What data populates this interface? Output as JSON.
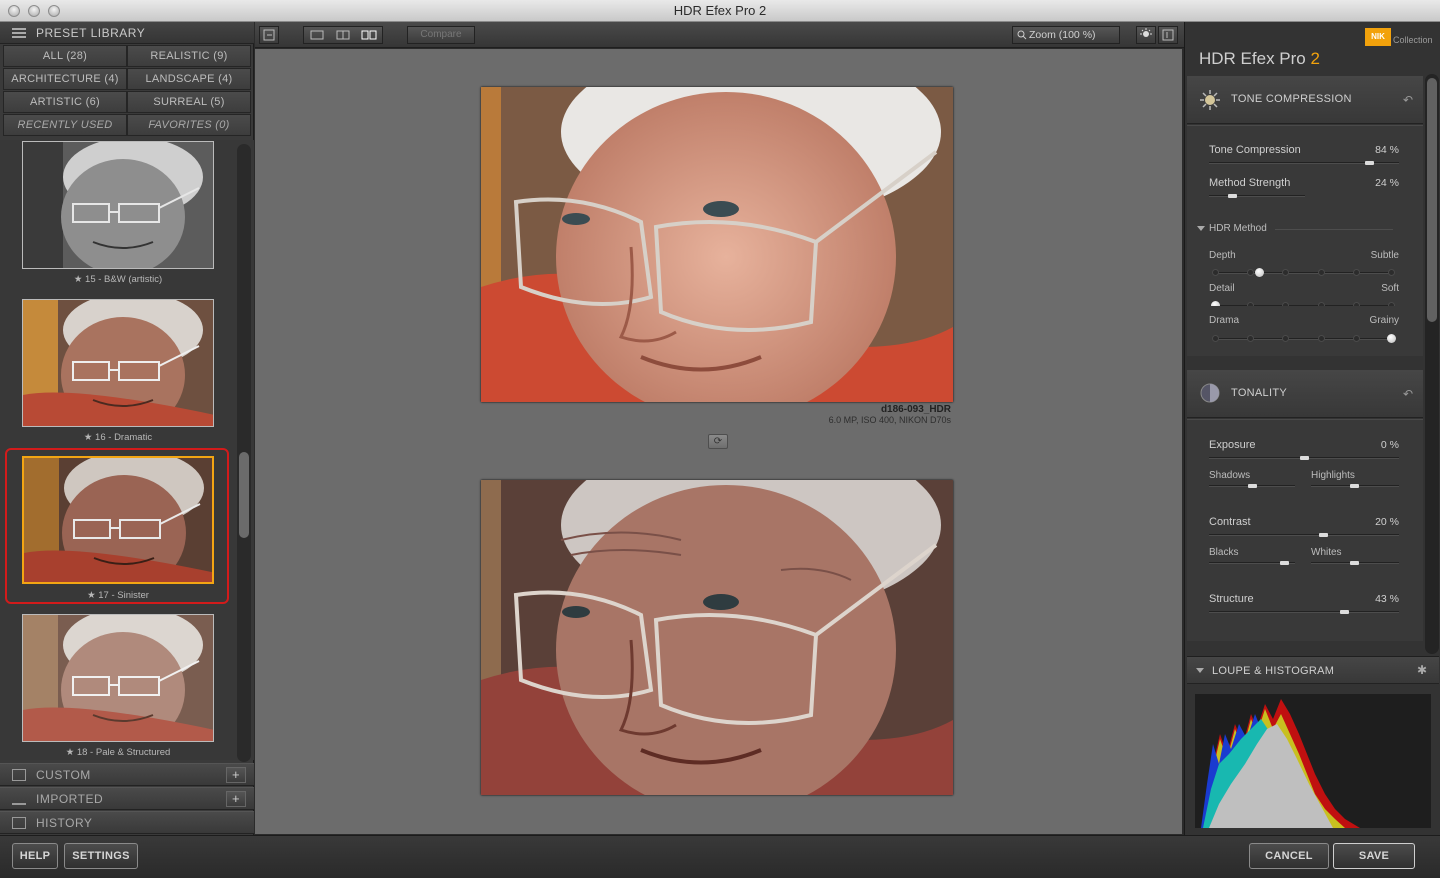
{
  "window": {
    "title": "HDR Efex Pro 2"
  },
  "left_panel": {
    "header": "PRESET LIBRARY",
    "categories": [
      {
        "label": "ALL (28)"
      },
      {
        "label": "REALISTIC (9)"
      },
      {
        "label": "ARCHITECTURE (4)"
      },
      {
        "label": "LANDSCAPE (4)"
      },
      {
        "label": "ARTISTIC (6)"
      },
      {
        "label": "SURREAL (5)"
      },
      {
        "label": "RECENTLY USED"
      },
      {
        "label": "FAVORITES (0)"
      }
    ],
    "presets": [
      {
        "label": "★ 15 - B&W (artistic)"
      },
      {
        "label": "★ 16 - Dramatic"
      },
      {
        "label": "★ 17 - Sinister"
      },
      {
        "label": "★ 18 - Pale & Structured"
      }
    ],
    "sections": [
      {
        "label": "CUSTOM"
      },
      {
        "label": "IMPORTED"
      },
      {
        "label": "HISTORY"
      }
    ]
  },
  "toolbar": {
    "compare_label": "Compare",
    "zoom_label": "Zoom (100 %)"
  },
  "canvas": {
    "image_name": "d186-093_HDR",
    "image_meta": "6.0 MP, ISO 400, NIKON D70s"
  },
  "right_panel": {
    "brand": "NIK",
    "brand_suffix": "Collection",
    "title": "HDR Efex Pro",
    "version": "2",
    "tone": {
      "header": "TONE COMPRESSION",
      "tone_compression": {
        "label": "Tone Compression",
        "value": "84 %",
        "level": 0.84
      },
      "method_strength": {
        "label": "Method Strength",
        "value": "24 %",
        "level": 0.24
      },
      "hdr_method": "HDR Method",
      "depth": {
        "left": "Depth",
        "right": "Subtle",
        "level": 0.25
      },
      "detail": {
        "left": "Detail",
        "right": "Soft",
        "level": 0.0
      },
      "drama": {
        "left": "Drama",
        "right": "Grainy",
        "level": 1.0
      }
    },
    "tonality": {
      "header": "TONALITY",
      "exposure": {
        "label": "Exposure",
        "value": "0 %",
        "level": 0.5
      },
      "shadows": "Shadows",
      "highlights": "Highlights",
      "contrast": {
        "label": "Contrast",
        "value": "20 %",
        "level": 0.6
      },
      "blacks": "Blacks",
      "whites": "Whites",
      "structure": {
        "label": "Structure",
        "value": "43 %",
        "level": 0.71
      }
    },
    "loupe": {
      "header": "LOUPE & HISTOGRAM"
    }
  },
  "bottom_bar": {
    "help": "HELP",
    "settings": "SETTINGS",
    "cancel": "CANCEL",
    "save": "SAVE"
  },
  "colors": {
    "accent": "#f2a20c",
    "selection_ring": "#d21b1b",
    "canvas_bg": "#6c6c6c"
  }
}
